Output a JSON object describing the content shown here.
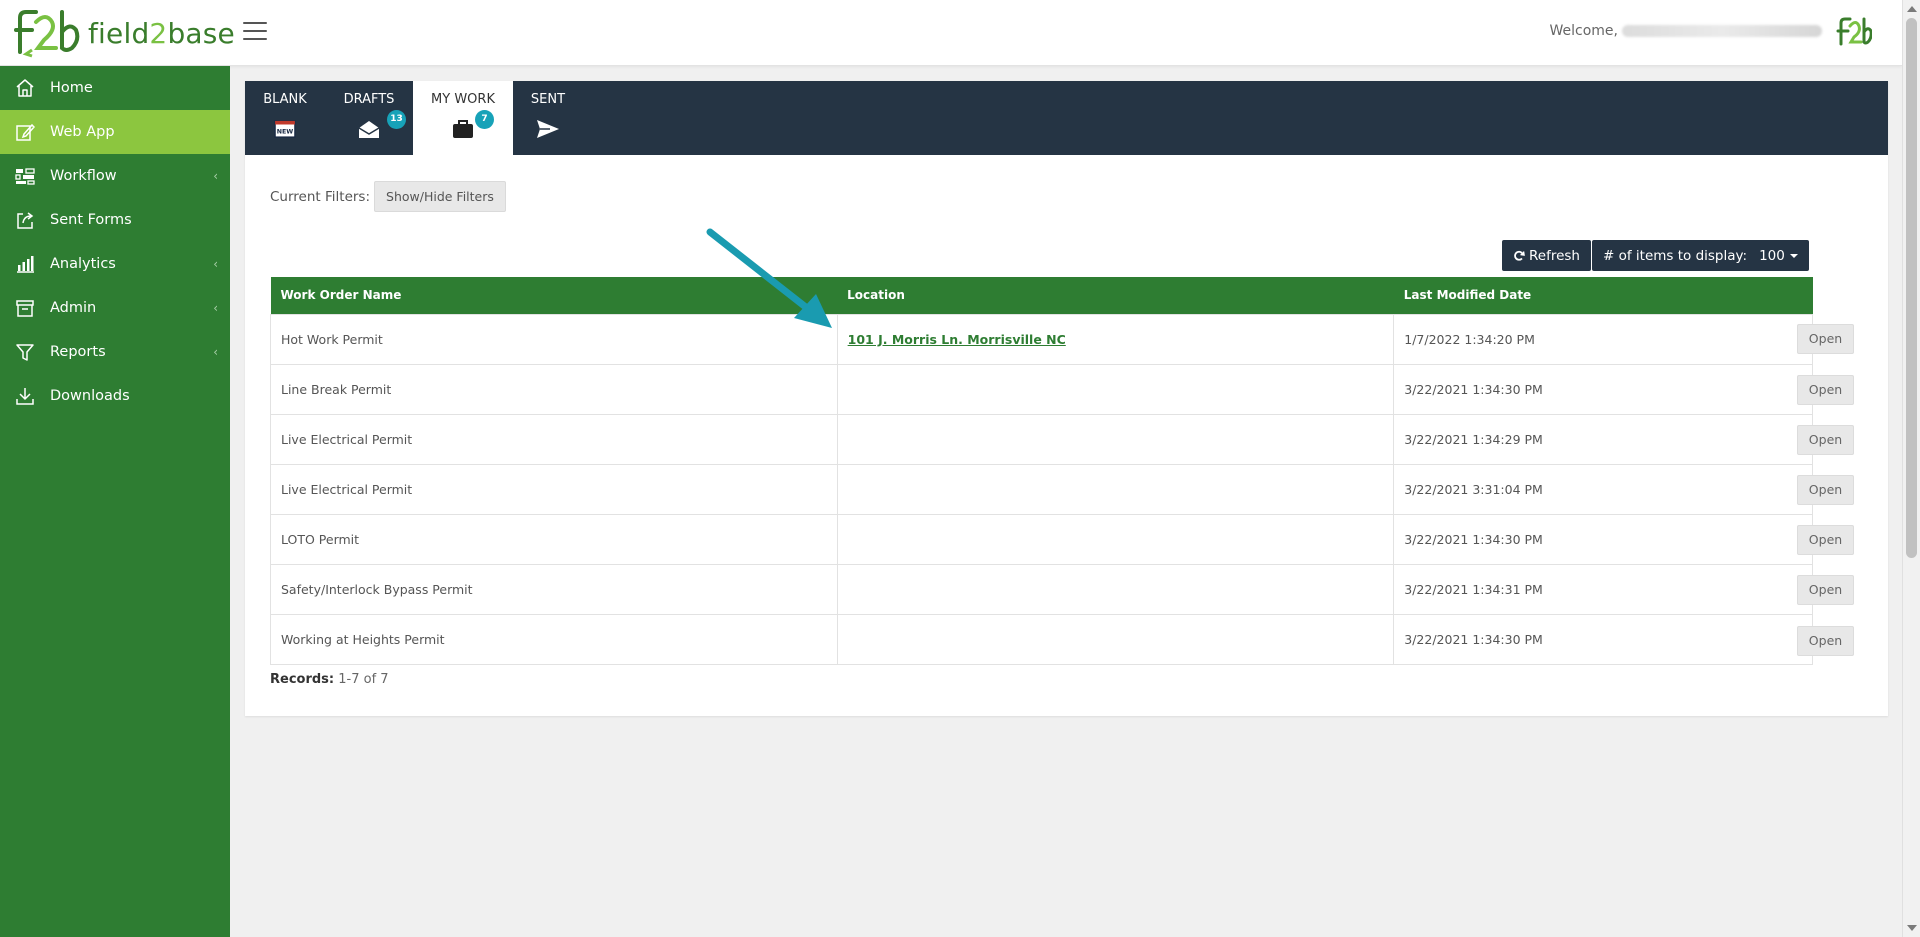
{
  "header": {
    "brand_name_part1": "field",
    "brand_name_part2": "2",
    "brand_name_part3": "base",
    "welcome": "Welcome,"
  },
  "sidebar": {
    "items": [
      {
        "label": "Home",
        "icon": "home-icon"
      },
      {
        "label": "Web App",
        "icon": "edit-icon",
        "active": true
      },
      {
        "label": "Workflow",
        "icon": "workflow-icon",
        "has_submenu": true
      },
      {
        "label": "Sent Forms",
        "icon": "share-icon"
      },
      {
        "label": "Analytics",
        "icon": "bar-chart-icon",
        "has_submenu": true
      },
      {
        "label": "Admin",
        "icon": "archive-icon",
        "has_submenu": true
      },
      {
        "label": "Reports",
        "icon": "filter-icon",
        "has_submenu": true
      },
      {
        "label": "Downloads",
        "icon": "download-icon"
      }
    ]
  },
  "tabs": {
    "blank": {
      "label": "BLANK",
      "icon_text": "NEW"
    },
    "drafts": {
      "label": "DRAFTS",
      "badge": "13"
    },
    "my_work": {
      "label": "MY WORK",
      "badge": "7",
      "active": true
    },
    "sent": {
      "label": "SENT"
    }
  },
  "filters": {
    "label": "Current Filters:",
    "button": "Show/Hide Filters"
  },
  "toolbar": {
    "refresh": "Refresh",
    "items_label": "# of items to display:",
    "items_value": "100"
  },
  "table": {
    "columns": [
      "Work Order Name",
      "Location",
      "Last Modified Date"
    ],
    "open_label": "Open",
    "rows": [
      {
        "name": "Hot Work Permit",
        "location": "101 J. Morris Ln. Morrisville NC",
        "date": "1/7/2022 1:34:20 PM"
      },
      {
        "name": "Line Break Permit",
        "location": "",
        "date": "3/22/2021 1:34:30 PM"
      },
      {
        "name": "Live Electrical Permit",
        "location": "",
        "date": "3/22/2021 1:34:29 PM"
      },
      {
        "name": "Live Electrical Permit",
        "location": "",
        "date": "3/22/2021 3:31:04 PM"
      },
      {
        "name": "LOTO Permit",
        "location": "",
        "date": "3/22/2021 1:34:30 PM"
      },
      {
        "name": "Safety/Interlock Bypass Permit",
        "location": "",
        "date": "3/22/2021 1:34:31 PM"
      },
      {
        "name": "Working at Heights Permit",
        "location": "",
        "date": "3/22/2021 1:34:30 PM"
      }
    ]
  },
  "records": {
    "label": "Records:",
    "value": "1-7 of 7"
  },
  "colors": {
    "sidebar": "#2e7d32",
    "sidebar_active": "#8cc63f",
    "tabbar": "#253444",
    "badge": "#17a2b8",
    "annotation_arrow": "#1a9bb0"
  }
}
